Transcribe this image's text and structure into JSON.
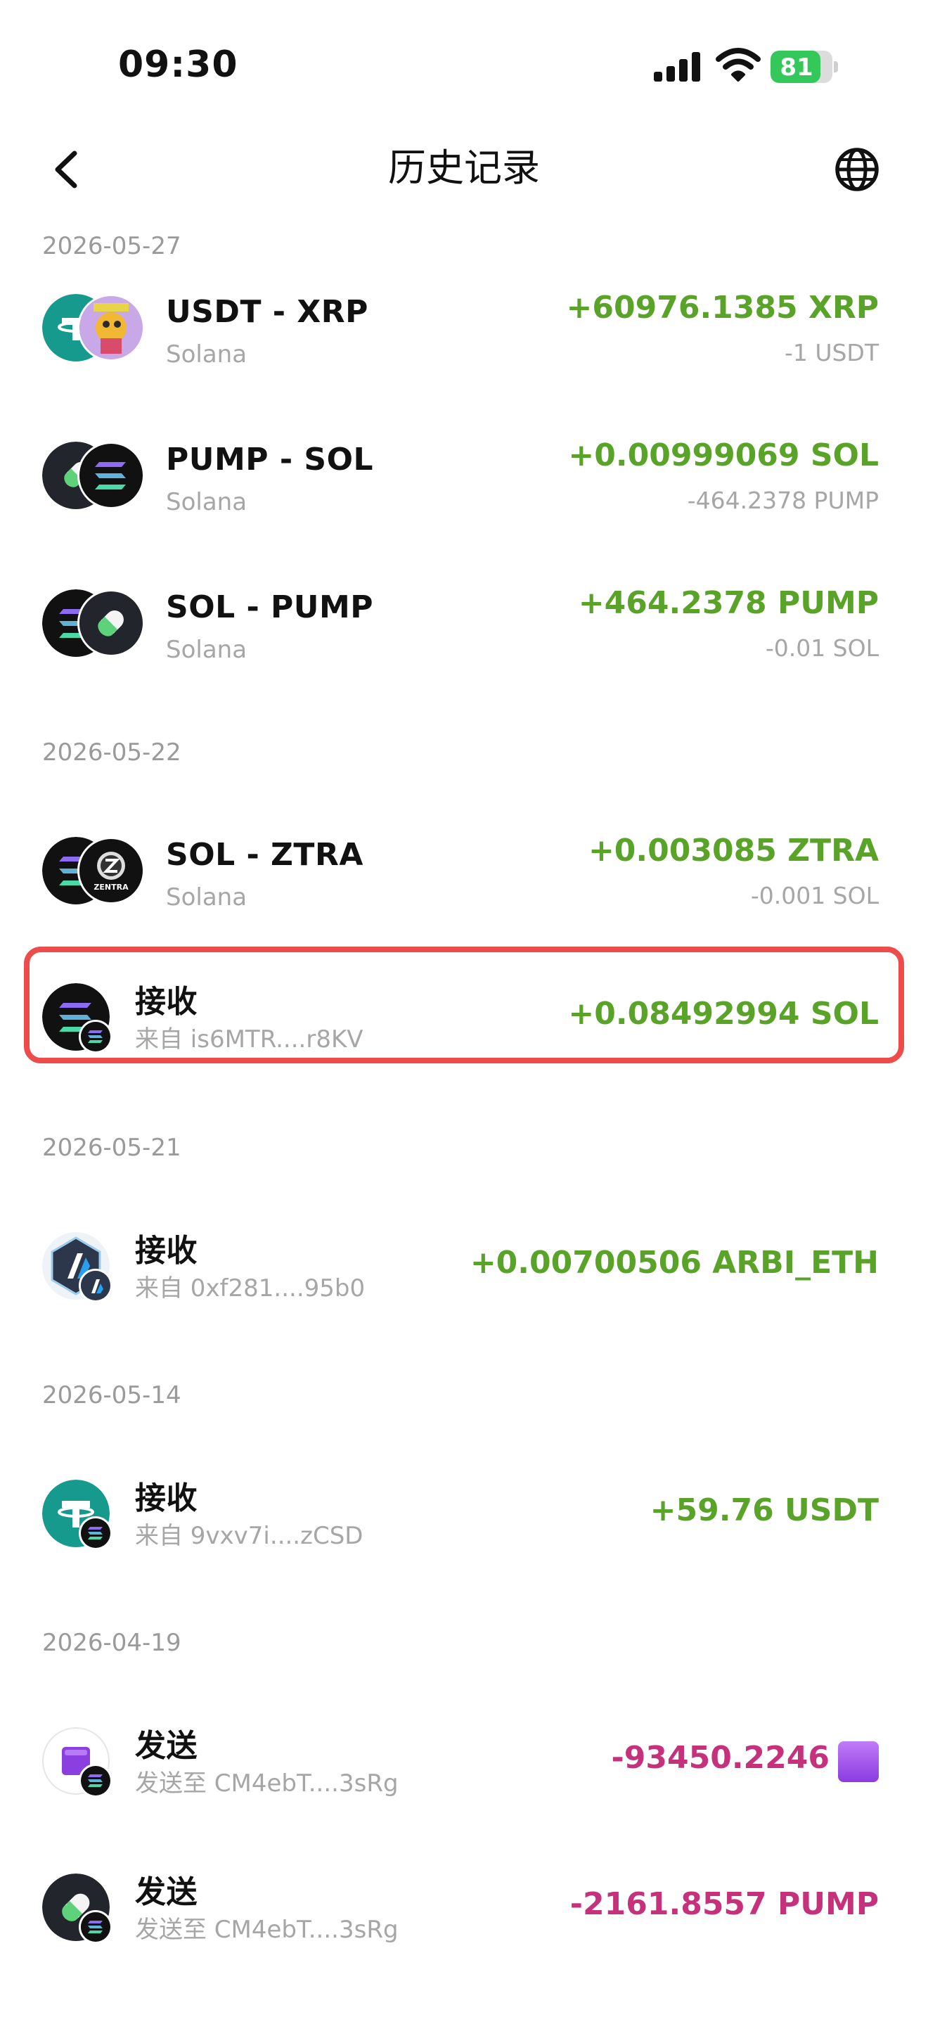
{
  "status_bar": {
    "time": "09:30",
    "battery": "81",
    "battery_level": 0.81
  },
  "header": {
    "title": "历史记录",
    "back_icon": "chevron-left-icon",
    "globe_icon": "globe-icon"
  },
  "colors": {
    "positive": "#5aa329",
    "negative": "#c5317a",
    "highlight": "#ee4b4b",
    "muted": "#a6a6a6"
  },
  "groups": [
    {
      "date": "2026-05-27",
      "items": [
        {
          "title": "USDT - XRP",
          "subtitle": "Solana",
          "amount": "+60976.1385 XRP",
          "amount_secondary": "-1 USDT"
        },
        {
          "title": "PUMP - SOL",
          "subtitle": "Solana",
          "amount": "+0.00999069 SOL",
          "amount_secondary": "-464.2378 PUMP"
        },
        {
          "title": "SOL - PUMP",
          "subtitle": "Solana",
          "amount": "+464.2378 PUMP",
          "amount_secondary": "-0.01 SOL"
        }
      ]
    },
    {
      "date": "2026-05-22",
      "items": [
        {
          "title": "SOL - ZTRA",
          "subtitle": "Solana",
          "amount": "+0.003085 ZTRA",
          "amount_secondary": "-0.001 SOL",
          "icon_text": "ZENTRA"
        },
        {
          "title": "接收",
          "subtitle": "来自 is6MTR....r8KV",
          "amount": "+0.08492994 SOL"
        }
      ]
    },
    {
      "date": "2026-05-21",
      "items": [
        {
          "title": "接收",
          "subtitle": "来自 0xf281....95b0",
          "amount": "+0.00700506 ARBI_ETH"
        }
      ]
    },
    {
      "date": "2026-05-14",
      "items": [
        {
          "title": "接收",
          "subtitle": "来自 9vxv7i....zCSD",
          "amount": "+59.76 USDT"
        }
      ]
    },
    {
      "date": "2026-04-19",
      "items": [
        {
          "title": "发送",
          "subtitle": "发送至 CM4ebT....3sRg",
          "amount": "-93450.2246"
        },
        {
          "title": "发送",
          "subtitle": "发送至 CM4ebT....3sRg",
          "amount": "-2161.8557 PUMP"
        }
      ]
    }
  ]
}
